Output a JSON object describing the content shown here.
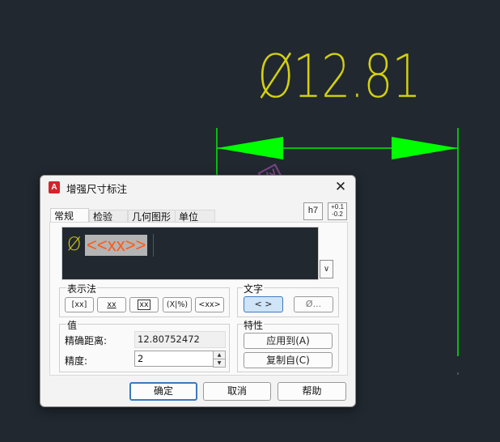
{
  "canvas": {
    "dimension_text": "Ø12.81",
    "watermark": "锦技网",
    "dim_color": "#d4d010",
    "arrow_color": "#00ff00",
    "line_color": "#00ee00",
    "background": "#212830"
  },
  "dialog": {
    "app_icon_letter": "A",
    "title": "增强尺寸标注",
    "close_label": "✕",
    "tabs": [
      {
        "label": "常规",
        "active": true
      },
      {
        "label": "检验",
        "active": false
      },
      {
        "label": "几何图形",
        "active": false
      },
      {
        "label": "单位",
        "active": false
      }
    ],
    "tolerance_buttons": {
      "fit": "h7",
      "limits_upper": "+0.1",
      "limits_lower": "-0.2"
    },
    "editor": {
      "prefix_symbol": "Ø",
      "selected_text": "<<xx>>"
    },
    "notation": {
      "label": "表示法",
      "buttons": [
        "[xx]",
        "xx",
        "xx",
        "(X|%)",
        "<xx>"
      ]
    },
    "text": {
      "label": "文字",
      "buttons": [
        "< >",
        "Ø..."
      ]
    },
    "value": {
      "label": "值",
      "exact_distance_label": "精确距离:",
      "exact_distance_value": "12.80752472",
      "precision_label": "精度:",
      "precision_value": "2"
    },
    "properties": {
      "label": "特性",
      "apply_to": "应用到(A)",
      "copy_from": "复制自(C)"
    },
    "footer": {
      "ok": "确定",
      "cancel": "取消",
      "help": "帮助"
    }
  }
}
